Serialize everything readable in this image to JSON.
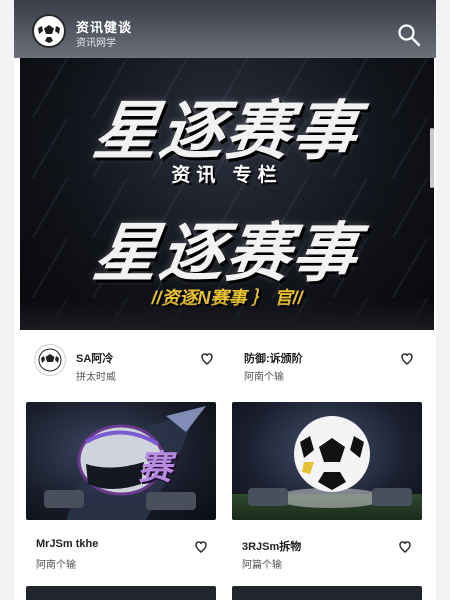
{
  "header": {
    "title": "资讯健谈",
    "subtitle": "资讯网学"
  },
  "hero": {
    "title_top": "星逐赛事",
    "subtitle": "资讯 专栏",
    "title_bottom": "星逐赛事",
    "tagline": "//资逐N赛事 ｝ 官//"
  },
  "info_rows": [
    {
      "title": "SA阿冷",
      "meta": "拼太时威"
    },
    {
      "title": "防御:诉颁阶",
      "meta": "阿南个输"
    }
  ],
  "cards": [
    {
      "title": "MrJSm tkhe",
      "meta": "阿南个输",
      "image": "helmet-player",
      "overlay_text": "赛"
    },
    {
      "title": "3RJSm拆物",
      "meta": "阿篇个输",
      "image": "soccer-ball"
    }
  ],
  "colors": {
    "accent_yellow": "#e8c233",
    "header_bg": "#575b66",
    "hero_bg": "#12141b"
  }
}
